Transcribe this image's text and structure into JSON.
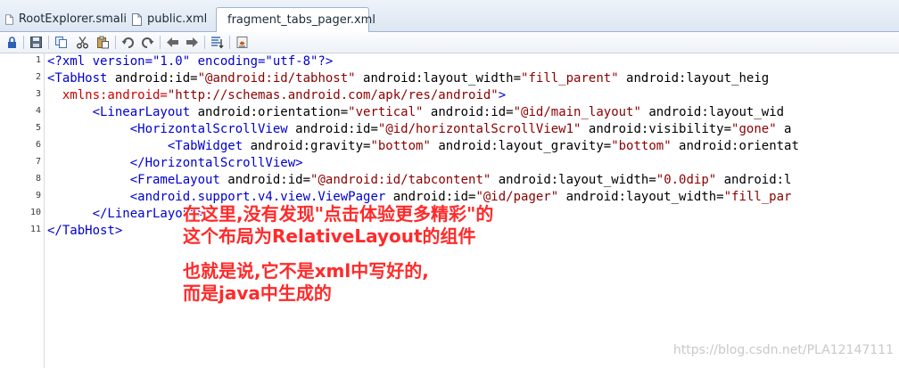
{
  "tabs": [
    {
      "label": "RootExplorer.smali",
      "active": false
    },
    {
      "label": "public.xml",
      "active": false
    },
    {
      "label": "fragment_tabs_pager.xml",
      "active": true
    }
  ],
  "toolbar": {
    "icons": [
      "lock-icon",
      "save-icon",
      "copy-icon",
      "cut-icon",
      "paste-icon",
      "undo-icon",
      "redo-icon",
      "back-icon",
      "forward-icon",
      "format-icon",
      "compile-icon"
    ]
  },
  "editor": {
    "line_numbers": [
      "1",
      "2",
      "3",
      "4",
      "5",
      "6",
      "7",
      "8",
      "9",
      "10",
      "11"
    ],
    "lines": [
      [
        {
          "k": "t",
          "v": "<?xml version=\"1.0\" encoding=\"utf-8\"?>"
        }
      ],
      [
        {
          "k": "t",
          "v": "<TabHost"
        },
        {
          "k": "p",
          "v": " android:id="
        },
        {
          "k": "s",
          "v": "\"@android:id/tabhost\""
        },
        {
          "k": "p",
          "v": " android:layout_width="
        },
        {
          "k": "s",
          "v": "\"fill_parent\""
        },
        {
          "k": "p",
          "v": " android:layout_heig"
        }
      ],
      [
        {
          "k": "p",
          "v": "  "
        },
        {
          "k": "ns",
          "v": "xmlns:android="
        },
        {
          "k": "s",
          "v": "\"http://schemas.android.com/apk/res/android\""
        },
        {
          "k": "t",
          "v": ">"
        }
      ],
      [
        {
          "k": "p",
          "v": "      "
        },
        {
          "k": "t",
          "v": "<LinearLayout"
        },
        {
          "k": "p",
          "v": " android:orientation="
        },
        {
          "k": "s",
          "v": "\"vertical\""
        },
        {
          "k": "p",
          "v": " android:id="
        },
        {
          "k": "s",
          "v": "\"@id/main_layout\""
        },
        {
          "k": "p",
          "v": " android:layout_wid"
        }
      ],
      [
        {
          "k": "p",
          "v": "           "
        },
        {
          "k": "t",
          "v": "<HorizontalScrollView"
        },
        {
          "k": "p",
          "v": " android:id="
        },
        {
          "k": "s",
          "v": "\"@id/horizontalScrollView1\""
        },
        {
          "k": "p",
          "v": " android:visibility="
        },
        {
          "k": "s",
          "v": "\"gone\""
        },
        {
          "k": "p",
          "v": " a"
        }
      ],
      [
        {
          "k": "p",
          "v": "                "
        },
        {
          "k": "t",
          "v": "<TabWidget"
        },
        {
          "k": "p",
          "v": " android:gravity="
        },
        {
          "k": "s",
          "v": "\"bottom\""
        },
        {
          "k": "p",
          "v": " android:layout_gravity="
        },
        {
          "k": "s",
          "v": "\"bottom\""
        },
        {
          "k": "p",
          "v": " android:orientat"
        }
      ],
      [
        {
          "k": "p",
          "v": "           "
        },
        {
          "k": "t",
          "v": "</HorizontalScrollView>"
        }
      ],
      [
        {
          "k": "p",
          "v": "           "
        },
        {
          "k": "t",
          "v": "<FrameLayout"
        },
        {
          "k": "p",
          "v": " android:id="
        },
        {
          "k": "s",
          "v": "\"@android:id/tabcontent\""
        },
        {
          "k": "p",
          "v": " android:layout_width="
        },
        {
          "k": "s",
          "v": "\"0.0dip\""
        },
        {
          "k": "p",
          "v": " android:l"
        }
      ],
      [
        {
          "k": "p",
          "v": "           "
        },
        {
          "k": "t",
          "v": "<android.support.v4.view.ViewPager"
        },
        {
          "k": "p",
          "v": " android:id="
        },
        {
          "k": "s",
          "v": "\"@id/pager\""
        },
        {
          "k": "p",
          "v": " android:layout_width="
        },
        {
          "k": "s",
          "v": "\"fill_par"
        }
      ],
      [
        {
          "k": "p",
          "v": "      "
        },
        {
          "k": "t",
          "v": "</LinearLayout>"
        }
      ],
      [
        {
          "k": "t",
          "v": "</TabHost>"
        }
      ]
    ]
  },
  "annotation": {
    "line1": "在这里,没有发现\"点击体验更多精彩\"的",
    "line2": "这个布局为RelativeLayout的组件",
    "line3": "也就是说,它不是xml中写好的,",
    "line4": "而是java中生成的"
  },
  "watermark": "https://blog.csdn.net/PLA12147111",
  "colors": {
    "tag": "#0000d0",
    "string": "#8b0000",
    "annotation": "#ff2a2a"
  }
}
